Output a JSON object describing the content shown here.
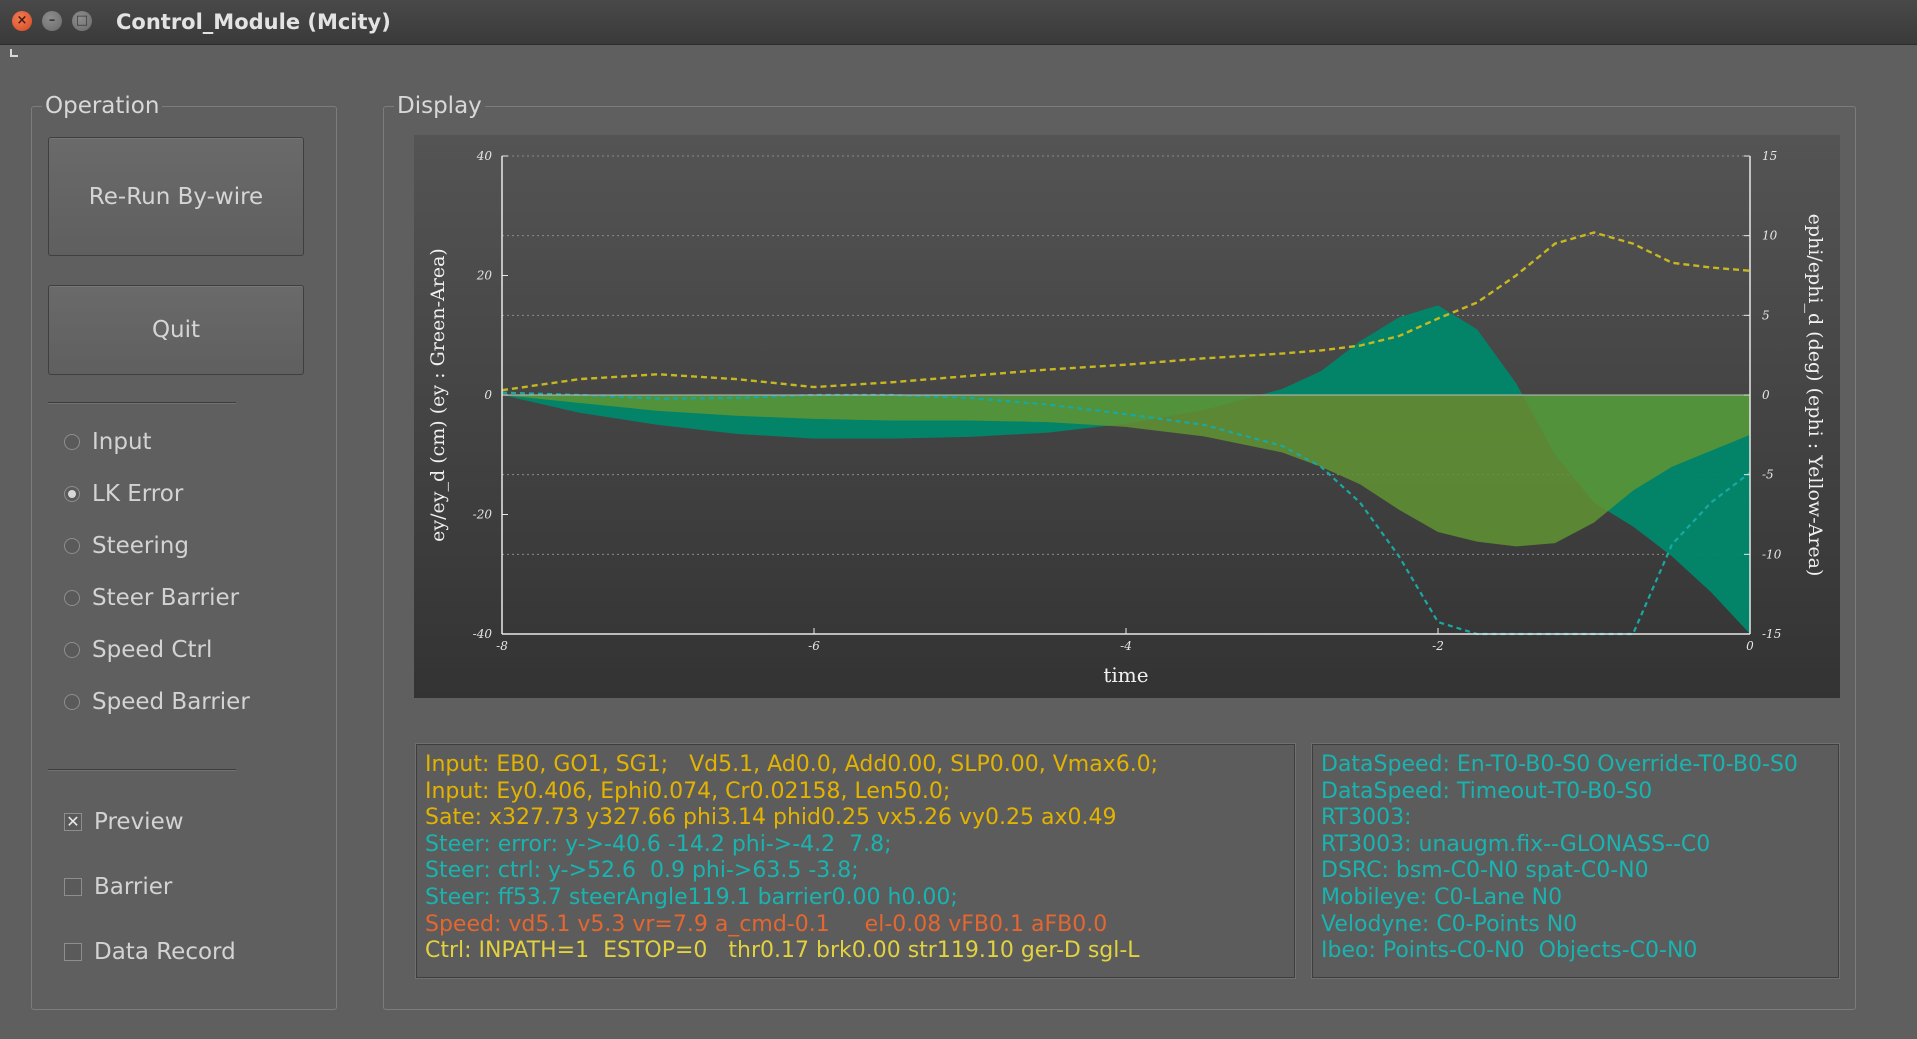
{
  "window": {
    "title": "Control_Module (Mcity)"
  },
  "operation": {
    "title": "Operation",
    "rerun_label": "Re-Run By-wire",
    "quit_label": "Quit",
    "radios": [
      {
        "label": "Input",
        "selected": false
      },
      {
        "label": "LK Error",
        "selected": true
      },
      {
        "label": "Steering",
        "selected": false
      },
      {
        "label": "Steer Barrier",
        "selected": false
      },
      {
        "label": "Speed  Ctrl",
        "selected": false
      },
      {
        "label": "Speed Barrier",
        "selected": false
      }
    ],
    "checks": [
      {
        "label": "Preview",
        "checked": true
      },
      {
        "label": "Barrier",
        "checked": false
      },
      {
        "label": "Data Record",
        "checked": false
      }
    ]
  },
  "display": {
    "title": "Display"
  },
  "chart_data": {
    "type": "area",
    "xlabel": "time",
    "ylabel_left": "ey/ey_d (cm) (ey : Green-Area)",
    "ylabel_right": "ephi/ephi_d (deg) (ephi : Yellow-Area)",
    "xlim": [
      -8,
      0
    ],
    "ylim_left": [
      -40,
      40
    ],
    "ylim_right": [
      -15,
      15
    ],
    "x_ticks": [
      "-8",
      "-6",
      "-4",
      "-2",
      "0"
    ],
    "y_left_ticks": [
      "40",
      "20",
      "0",
      "-20",
      "-40"
    ],
    "y_right_ticks": [
      "15",
      "10",
      "5",
      "0",
      "-5",
      "-10",
      "-15"
    ],
    "grid": true,
    "colors": {
      "green_area": "#00876a",
      "yellow_area": "#7d8a27",
      "green_area_light": "#4d9e3a",
      "yellow_line": "#c8b820",
      "cyan_line": "#1aa8a3"
    },
    "x": [
      -8,
      -7.5,
      -7,
      -6.5,
      -6,
      -5.5,
      -5,
      -4.5,
      -4,
      -3.5,
      -3,
      -2.75,
      -2.5,
      -2.25,
      -2,
      -1.75,
      -1.5,
      -1.25,
      -1,
      -0.75,
      -0.5,
      -0.25,
      0
    ],
    "series": [
      {
        "name": "ey",
        "axis": "left",
        "values": [
          0,
          -3,
          -5,
          -6.5,
          -7.3,
          -7.3,
          -7,
          -6.3,
          -4.8,
          -2.5,
          1,
          4,
          9,
          13,
          15,
          11,
          2,
          -10,
          -18,
          -22,
          -27,
          -33,
          -40
        ]
      },
      {
        "name": "ey_d",
        "axis": "left",
        "values": [
          0.4,
          0,
          -0.6,
          -0.5,
          0,
          0,
          -0.5,
          -1.6,
          -3.2,
          -5,
          -8.5,
          -12,
          -18,
          -27,
          -38,
          -52,
          -62,
          -66,
          -58,
          -43,
          -25,
          -18,
          -13
        ]
      },
      {
        "name": "ephi",
        "axis": "right",
        "values": [
          0,
          -0.5,
          -1,
          -1.3,
          -1.5,
          -1.6,
          -1.6,
          -1.7,
          -2,
          -2.6,
          -3.6,
          -4.5,
          -5.6,
          -7.2,
          -8.6,
          -9.2,
          -9.5,
          -9.3,
          -8,
          -6,
          -4.5,
          -3.5,
          -2.5
        ]
      },
      {
        "name": "ephi_d",
        "axis": "right",
        "values": [
          0.3,
          1,
          1.3,
          1,
          0.5,
          0.8,
          1.2,
          1.6,
          1.9,
          2.3,
          2.6,
          2.8,
          3.1,
          3.7,
          4.8,
          5.8,
          7.5,
          9.5,
          10.2,
          9.5,
          8.3,
          8,
          7.8
        ]
      }
    ]
  },
  "status_left": [
    {
      "text": "Input: EB0, GO1, SG1;   Vd5.1, Ad0.0, Add0.00, SLP0.00, Vmax6.0;",
      "color": "#e3b300"
    },
    {
      "text": "Input: Ey0.406, Ephi0.074, Cr0.02158, Len50.0;",
      "color": "#e3b300"
    },
    {
      "text": "Sate: x327.73 y327.66 phi3.14 phid0.25 vx5.26 vy0.25 ax0.49",
      "color": "#e3b300"
    },
    {
      "text": "Steer: error: y->-40.6 -14.2 phi->-4.2  7.8;",
      "color": "#19b3b0"
    },
    {
      "text": "Steer: ctrl: y->52.6  0.9 phi->63.5 -3.8;",
      "color": "#19b3b0"
    },
    {
      "text": "Steer: ff53.7 steerAngle119.1 barrier0.00 h0.00;",
      "color": "#19b3b0"
    },
    {
      "text": "Speed: vd5.1 v5.3 vr=7.9 a_cmd-0.1     el-0.08 vFB0.1 aFB0.0",
      "color": "#e5672f"
    },
    {
      "text": "Ctrl: INPATH=1  ESTOP=0   thr0.17 brk0.00 str119.10 ger-D sgl-L",
      "color": "#e1d240"
    }
  ],
  "status_right": [
    {
      "text": "DataSpeed: En-T0-B0-S0 Override-T0-B0-S0"
    },
    {
      "text": "DataSpeed: Timeout-T0-B0-S0"
    },
    {
      "text": "RT3003:"
    },
    {
      "text": "RT3003: unaugm.fix--GLONASS--C0"
    },
    {
      "text": "DSRC: bsm-C0-N0 spat-C0-N0"
    },
    {
      "text": "Mobileye: C0-Lane N0"
    },
    {
      "text": "Velodyne: C0-Points N0"
    },
    {
      "text": "Ibeo: Points-C0-N0  Objects-C0-N0"
    }
  ]
}
